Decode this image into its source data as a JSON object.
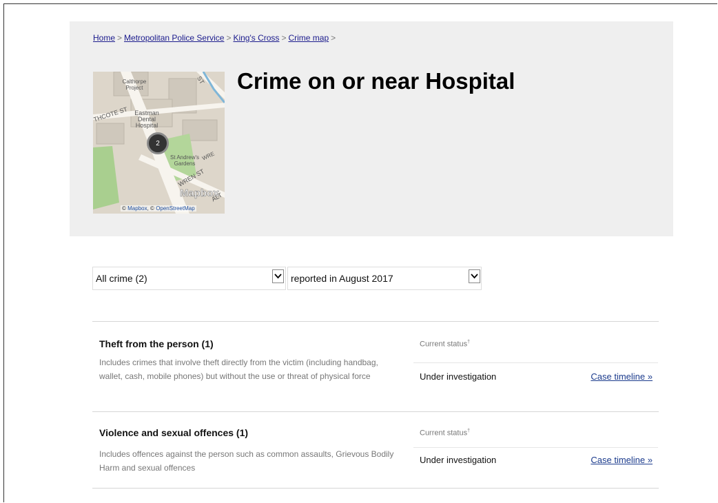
{
  "breadcrumb": {
    "home": "Home",
    "force": "Metropolitan Police Service",
    "area": "King's Cross",
    "map": "Crime map",
    "sep": ">"
  },
  "map": {
    "labels": {
      "calthorpe": "Calthorpe Project",
      "street_left": "THCOTE ST",
      "street_top": "ST",
      "hospital": "Eastman Dental Hospital",
      "gardens": "St Andrew's Gardens",
      "wren": "WREN ST",
      "wre": "WRE",
      "alt": "ALT"
    },
    "cluster_count": "2",
    "logo": "Mapbox",
    "attribution": {
      "prefix": "©",
      "mapbox": "Mapbox",
      "osm": "OpenStreetMap",
      "sep": ", ©"
    }
  },
  "page_title": "Crime on or near Hospital",
  "filters": {
    "category": "All crime (2)",
    "period": "reported in August 2017"
  },
  "crimes": [
    {
      "title": "Theft from the person (1)",
      "description": "Includes crimes that involve theft directly from the victim (including handbag, wallet, cash, mobile phones) but without the use or threat of physical force",
      "status_heading": "Current status",
      "status_mark": "†",
      "status": "Under investigation",
      "timeline_link": "Case timeline »"
    },
    {
      "title": "Violence and sexual offences (1)",
      "description": "Includes offences against the person such as common assaults, Grievous Bodily Harm and sexual offences",
      "status_heading": "Current status",
      "status_mark": "†",
      "status": "Under investigation",
      "timeline_link": "Case timeline »"
    }
  ],
  "icons": {
    "dropdown": "chevron-down-icon"
  },
  "colors": {
    "header_bg": "#efefef",
    "link": "#1a1a8c",
    "rule": "#d5d5d5"
  }
}
